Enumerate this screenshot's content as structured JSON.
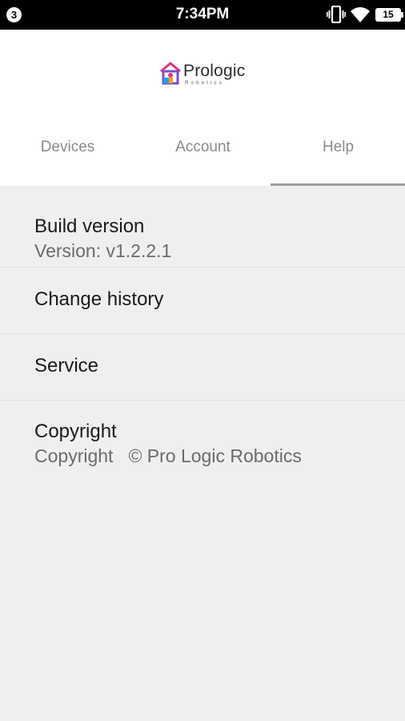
{
  "status_bar": {
    "notification_count": "3",
    "time": "7:34PM",
    "battery_level": "15",
    "icons": [
      "vibrate-icon",
      "wifi-icon",
      "battery-icon"
    ]
  },
  "header": {
    "logo_text": "Prologic",
    "logo_subtext": "Robotics",
    "logo_colors": [
      "#e4347c",
      "#2d9be0",
      "#f3a21c",
      "#7b4fc8"
    ]
  },
  "tabs": [
    {
      "label": "Devices",
      "active": false
    },
    {
      "label": "Account",
      "active": false
    },
    {
      "label": "Help",
      "active": true
    }
  ],
  "help_items": {
    "build": {
      "title": "Build version",
      "value": "Version: v1.2.2.1"
    },
    "change_history": {
      "title": "Change history"
    },
    "service": {
      "title": "Service"
    },
    "copyright": {
      "title": "Copyright",
      "label": "Copyright",
      "value": "© Pro Logic Robotics"
    }
  },
  "colors": {
    "background": "#efefef",
    "header_background": "#ffffff",
    "status_bar": "#000000",
    "tab_indicator": "#a0a0a0"
  }
}
